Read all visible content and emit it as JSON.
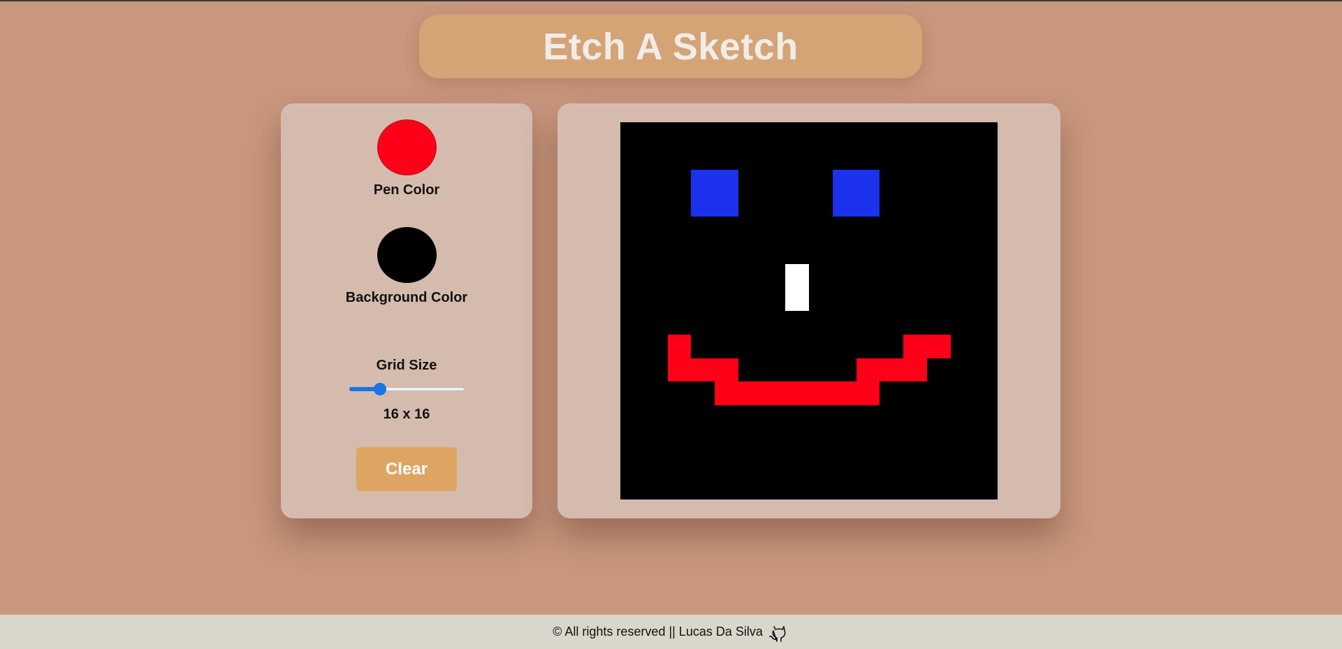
{
  "header": {
    "title": "Etch A Sketch"
  },
  "controls": {
    "pen_color": {
      "label": "Pen Color",
      "value": "#ff0019"
    },
    "background_color": {
      "label": "Background Color",
      "value": "#000000"
    },
    "grid_size": {
      "label": "Grid Size",
      "min": 1,
      "max": 64,
      "value": 16,
      "readout": "16 x 16"
    },
    "clear_label": "Clear"
  },
  "canvas": {
    "size": 16,
    "background": "#000000",
    "cells": [
      {
        "row": 2,
        "col": 3,
        "color": "#1c31ec"
      },
      {
        "row": 2,
        "col": 4,
        "color": "#1c31ec"
      },
      {
        "row": 2,
        "col": 9,
        "color": "#1c31ec"
      },
      {
        "row": 2,
        "col": 10,
        "color": "#1c31ec"
      },
      {
        "row": 3,
        "col": 3,
        "color": "#1c31ec"
      },
      {
        "row": 3,
        "col": 4,
        "color": "#1c31ec"
      },
      {
        "row": 3,
        "col": 9,
        "color": "#1c31ec"
      },
      {
        "row": 3,
        "col": 10,
        "color": "#1c31ec"
      },
      {
        "row": 6,
        "col": 7,
        "color": "#ffffff"
      },
      {
        "row": 7,
        "col": 7,
        "color": "#ffffff"
      },
      {
        "row": 9,
        "col": 2,
        "color": "#ff0019"
      },
      {
        "row": 9,
        "col": 12,
        "color": "#ff0019"
      },
      {
        "row": 9,
        "col": 13,
        "color": "#ff0019"
      },
      {
        "row": 10,
        "col": 2,
        "color": "#ff0019"
      },
      {
        "row": 10,
        "col": 3,
        "color": "#ff0019"
      },
      {
        "row": 10,
        "col": 4,
        "color": "#ff0019"
      },
      {
        "row": 10,
        "col": 10,
        "color": "#ff0019"
      },
      {
        "row": 10,
        "col": 11,
        "color": "#ff0019"
      },
      {
        "row": 10,
        "col": 12,
        "color": "#ff0019"
      },
      {
        "row": 11,
        "col": 4,
        "color": "#ff0019"
      },
      {
        "row": 11,
        "col": 5,
        "color": "#ff0019"
      },
      {
        "row": 11,
        "col": 6,
        "color": "#ff0019"
      },
      {
        "row": 11,
        "col": 7,
        "color": "#ff0019"
      },
      {
        "row": 11,
        "col": 8,
        "color": "#ff0019"
      },
      {
        "row": 11,
        "col": 9,
        "color": "#ff0019"
      },
      {
        "row": 11,
        "col": 10,
        "color": "#ff0019"
      }
    ]
  },
  "footer": {
    "text": "© All rights reserved || Lucas Da Silva",
    "icon": "github-icon"
  },
  "colors": {
    "page_background": "#c8977c",
    "title_bar": "#d4a477",
    "panel": "#d5bbae",
    "clear_button": "#dea562",
    "slider_accent": "#1a73e8",
    "footer_background": "#d9d7cc"
  }
}
